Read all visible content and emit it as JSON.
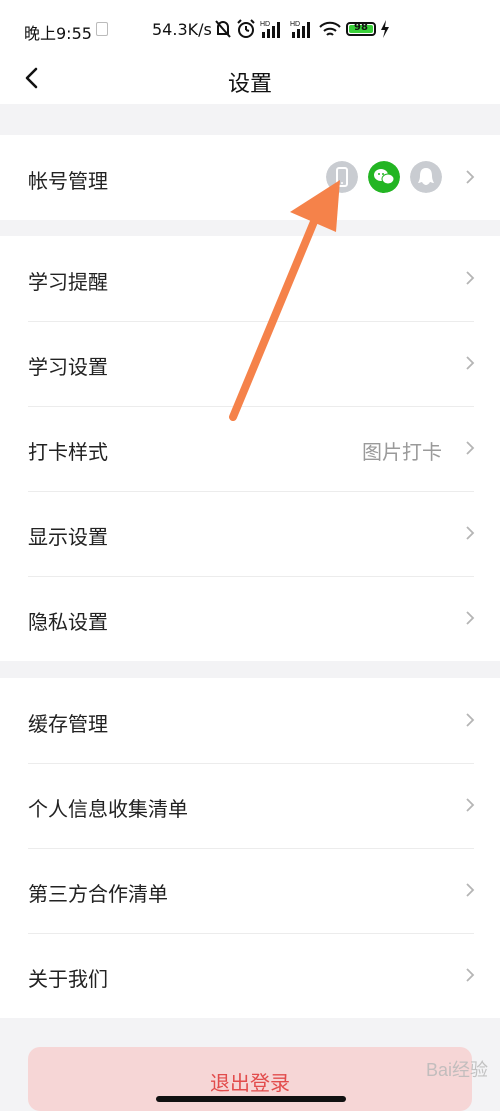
{
  "status_bar": {
    "time": "晚上9:55",
    "net_speed": "54.3K/s",
    "battery": "98",
    "icons": [
      "notification-muted-icon",
      "alarm-icon",
      "signal-hd-icon",
      "signal-hd-icon",
      "wifi-icon",
      "battery-icon",
      "charging-icon"
    ]
  },
  "nav": {
    "title": "设置",
    "back_icon": "back-arrow-icon"
  },
  "account": {
    "label": "帐号管理",
    "linked_icons": [
      "phone-icon",
      "wechat-icon",
      "qq-icon"
    ],
    "colors": {
      "phone": "#c9ccd1",
      "wechat": "#23b523",
      "qq": "#c9ccd1"
    }
  },
  "group2": [
    {
      "label": "学习提醒",
      "value": ""
    },
    {
      "label": "学习设置",
      "value": ""
    },
    {
      "label": "打卡样式",
      "value": "图片打卡"
    },
    {
      "label": "显示设置",
      "value": ""
    },
    {
      "label": "隐私设置",
      "value": ""
    }
  ],
  "group3": [
    {
      "label": "缓存管理"
    },
    {
      "label": "个人信息收集清单"
    },
    {
      "label": "第三方合作清单"
    },
    {
      "label": "关于我们"
    }
  ],
  "logout_label": "退出登录",
  "watermark": "Bai经验",
  "colors": {
    "annotation_arrow": "#f5824a",
    "logout_bg": "#f6d6d6",
    "logout_text": "#e24c4c"
  }
}
